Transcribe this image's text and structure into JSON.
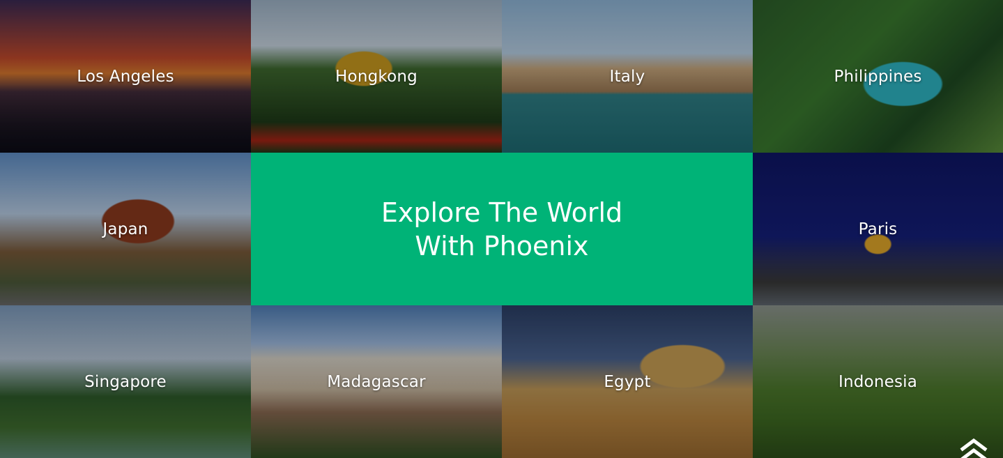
{
  "hero": {
    "title_line1": "Explore The World",
    "title_line2": "With Phoenix",
    "background_color": "#00b377"
  },
  "destinations": [
    {
      "name": "Los Angeles"
    },
    {
      "name": "Hongkong"
    },
    {
      "name": "Italy"
    },
    {
      "name": "Philippines"
    },
    {
      "name": "Japan"
    },
    {
      "name": "Paris"
    },
    {
      "name": "Singapore"
    },
    {
      "name": "Madagascar"
    },
    {
      "name": "Egypt"
    },
    {
      "name": "Indonesia"
    }
  ],
  "scroll_top": {
    "icon": "double-chevron-up-icon"
  }
}
